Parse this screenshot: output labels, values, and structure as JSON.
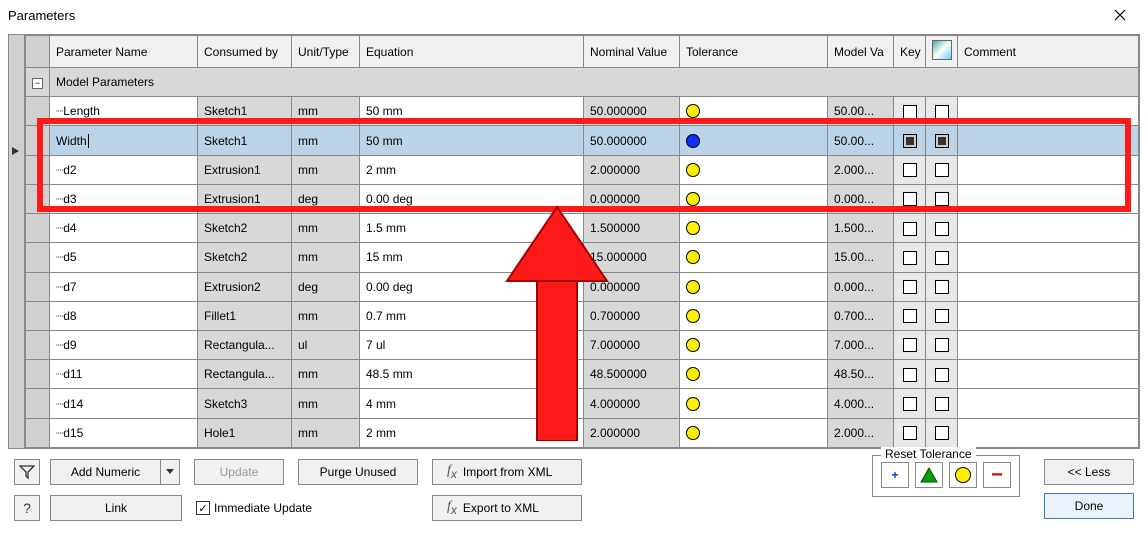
{
  "window": {
    "title": "Parameters"
  },
  "columns": {
    "name": "Parameter Name",
    "consumed": "Consumed by",
    "unit": "Unit/Type",
    "equation": "Equation",
    "nominal": "Nominal Value",
    "tolerance": "Tolerance",
    "modelv": "Model Va",
    "key": "Key",
    "comment": "Comment"
  },
  "group_label": "Model Parameters",
  "rows": [
    {
      "name": "Length",
      "consumed": "Sketch1",
      "unit": "mm",
      "equation": "50 mm",
      "nominal": "50.000000",
      "tol": "<Default>",
      "tolcolor": "#ffee00",
      "modelv": "50.00...",
      "selected": false
    },
    {
      "name": "Width",
      "consumed": "Sketch1",
      "unit": "mm",
      "equation": "50 mm",
      "nominal": "50.000000",
      "tol": "<Default>",
      "tolcolor": "#1030ff",
      "modelv": "50.00...",
      "selected": true,
      "editing": true
    },
    {
      "name": "d2",
      "consumed": "Extrusion1",
      "unit": "mm",
      "equation": "2 mm",
      "nominal": "2.000000",
      "tol": "<Default>",
      "tolcolor": "#ffee00",
      "modelv": "2.000...",
      "selected": false
    },
    {
      "name": "d3",
      "consumed": "Extrusion1",
      "unit": "deg",
      "equation": "0.00 deg",
      "nominal": "0.000000",
      "tol": "<Default>",
      "tolcolor": "#ffee00",
      "modelv": "0.000...",
      "selected": false
    },
    {
      "name": "d4",
      "consumed": "Sketch2",
      "unit": "mm",
      "equation": "1.5 mm",
      "nominal": "1.500000",
      "tol": "<Default>",
      "tolcolor": "#ffee00",
      "modelv": "1.500...",
      "selected": false
    },
    {
      "name": "d5",
      "consumed": "Sketch2",
      "unit": "mm",
      "equation": "15 mm",
      "nominal": "15.000000",
      "tol": "<Default>",
      "tolcolor": "#ffee00",
      "modelv": "15.00...",
      "selected": false
    },
    {
      "name": "d7",
      "consumed": "Extrusion2",
      "unit": "deg",
      "equation": "0.00 deg",
      "nominal": "0.000000",
      "tol": "<Default>",
      "tolcolor": "#ffee00",
      "modelv": "0.000...",
      "selected": false
    },
    {
      "name": "d8",
      "consumed": "Fillet1",
      "unit": "mm",
      "equation": "0.7 mm",
      "nominal": "0.700000",
      "tol": "<Default>",
      "tolcolor": "#ffee00",
      "modelv": "0.700...",
      "selected": false
    },
    {
      "name": "d9",
      "consumed": "Rectangula...",
      "unit": "ul",
      "equation": "7 ul",
      "nominal": "7.000000",
      "tol": "<Default>",
      "tolcolor": "#ffee00",
      "modelv": "7.000...",
      "selected": false
    },
    {
      "name": "d11",
      "consumed": "Rectangula...",
      "unit": "mm",
      "equation": "48.5 mm",
      "nominal": "48.500000",
      "tol": "<Default>",
      "tolcolor": "#ffee00",
      "modelv": "48.50...",
      "selected": false
    },
    {
      "name": "d14",
      "consumed": "Sketch3",
      "unit": "mm",
      "equation": "4 mm",
      "nominal": "4.000000",
      "tol": "<Default>",
      "tolcolor": "#ffee00",
      "modelv": "4.000...",
      "selected": false
    },
    {
      "name": "d15",
      "consumed": "Hole1",
      "unit": "mm",
      "equation": "2 mm",
      "nominal": "2.000000",
      "tol": "<Default>",
      "tolcolor": "#ffee00",
      "modelv": "2.000...",
      "selected": false
    }
  ],
  "footer": {
    "add_numeric": "Add Numeric",
    "update": "Update",
    "purge": "Purge Unused",
    "import": "Import from XML",
    "export": "Export to XML",
    "link": "Link",
    "immediate": "Immediate Update",
    "reset_tol": "Reset Tolerance",
    "less": "<< Less",
    "done": "Done"
  }
}
